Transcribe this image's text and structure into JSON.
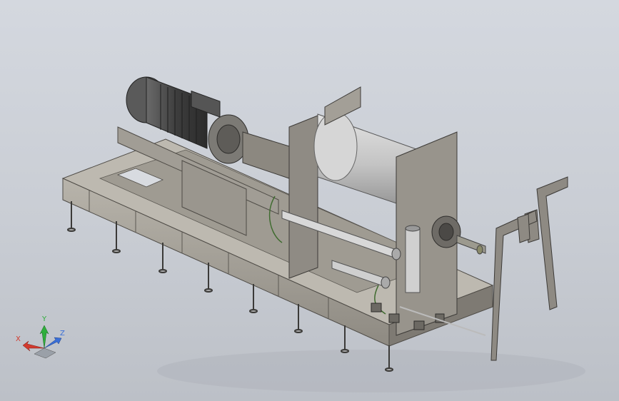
{
  "viewport": {
    "background_top": "#d4d8df",
    "background_bottom": "#bcc0c7",
    "model_color": "#a9a59c",
    "model_dark": "#5f5c57",
    "drum_color": "#c7c7c7",
    "motor_color": "#4a4a4a"
  },
  "triad": {
    "x_label": "X",
    "y_label": "Y",
    "z_label": "Z",
    "x_color": "#d23a2e",
    "y_color": "#2fae3c",
    "z_color": "#3a6fd8"
  }
}
